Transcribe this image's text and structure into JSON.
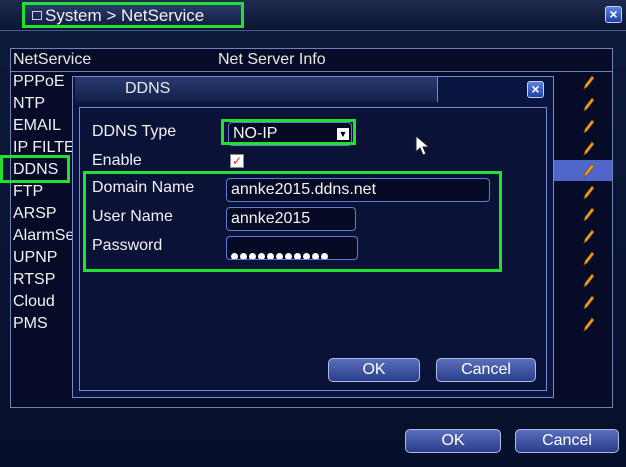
{
  "window": {
    "title": "System > NetService",
    "close_glyph": "×"
  },
  "list": {
    "headers": [
      "NetService",
      "Net Server Info"
    ],
    "rows": [
      {
        "label": "PPPoE"
      },
      {
        "label": "NTP"
      },
      {
        "label": "EMAIL"
      },
      {
        "label": "IP FILTER"
      },
      {
        "label": "DDNS",
        "selected": true
      },
      {
        "label": "FTP"
      },
      {
        "label": "ARSP"
      },
      {
        "label": "AlarmServer"
      },
      {
        "label": "UPNP"
      },
      {
        "label": "RTSP"
      },
      {
        "label": "Cloud"
      },
      {
        "label": "PMS"
      }
    ],
    "edit_icon": "pencil-icon"
  },
  "dialog": {
    "title": "DDNS",
    "close_glyph": "×",
    "ddns_type_label": "DDNS Type",
    "ddns_type_value": "NO-IP",
    "enable_label": "Enable",
    "enable_checked": true,
    "check_glyph": "✓",
    "domain_label": "Domain Name",
    "domain_value": "annke2015.ddns.net",
    "user_label": "User Name",
    "user_value": "annke2015",
    "password_label": "Password",
    "password_length": 11,
    "ok_label": "OK",
    "cancel_label": "Cancel"
  },
  "footer": {
    "ok_label": "OK",
    "cancel_label": "Cancel"
  },
  "colors": {
    "highlight": "#22e032",
    "selection": "#4f66c8",
    "pencil": "#f0a020"
  }
}
